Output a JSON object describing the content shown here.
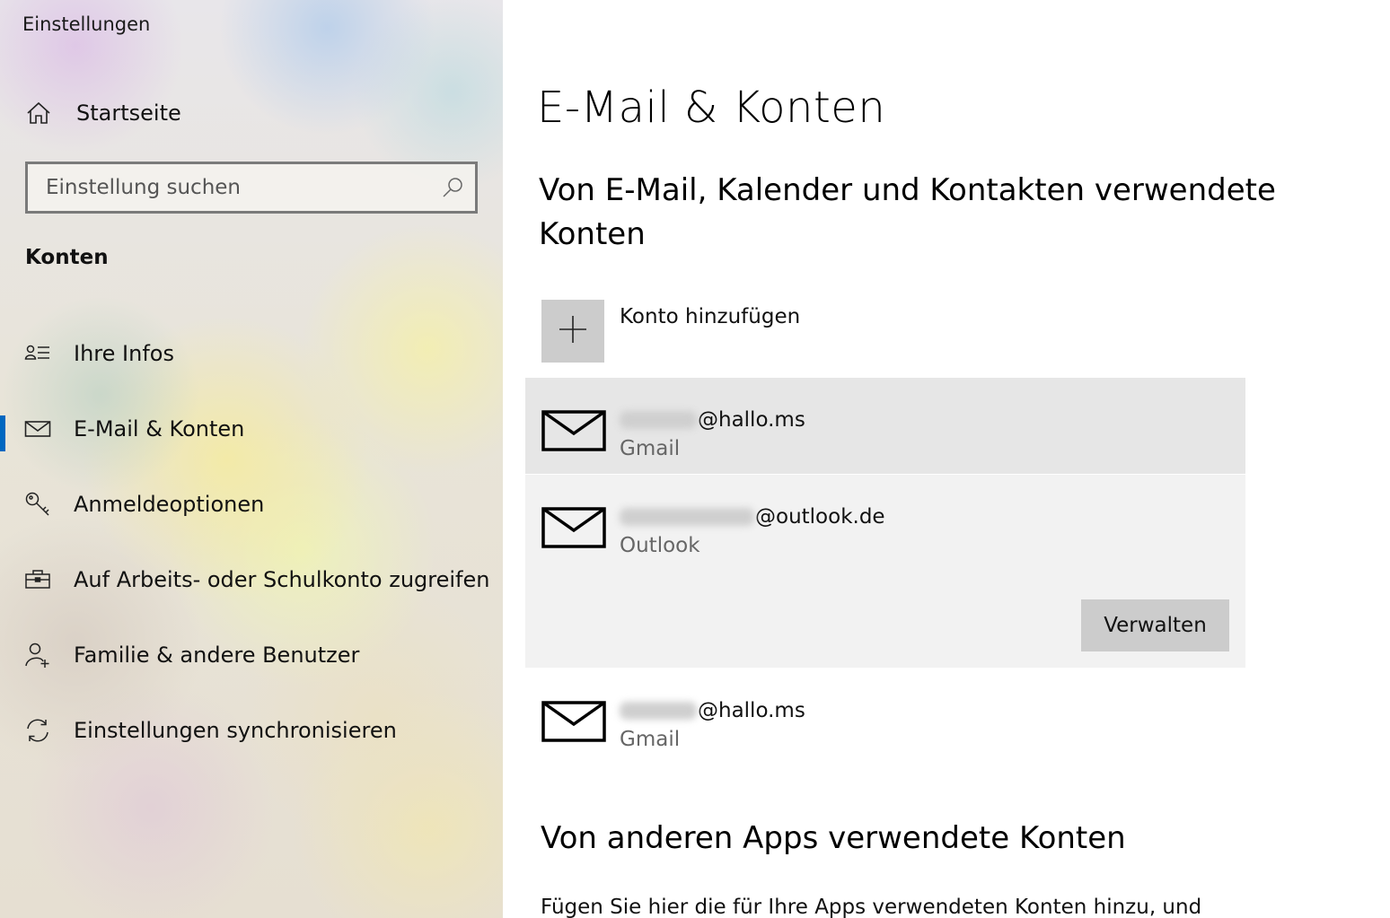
{
  "window": {
    "title": "Einstellungen"
  },
  "sidebar": {
    "home": {
      "label": "Startseite",
      "icon": "home-icon"
    },
    "search": {
      "placeholder": "Einstellung suchen",
      "value": "",
      "icon": "search-icon"
    },
    "section": "Konten",
    "items": [
      {
        "label": "Ihre Infos",
        "icon": "person-info-icon",
        "active": false
      },
      {
        "label": "E-Mail & Konten",
        "icon": "mail-icon",
        "active": true
      },
      {
        "label": "Anmeldeoptionen",
        "icon": "key-icon",
        "active": false
      },
      {
        "label": "Auf Arbeits- oder Schulkonto zugreifen",
        "icon": "briefcase-icon",
        "active": false
      },
      {
        "label": "Familie & andere Benutzer",
        "icon": "add-person-icon",
        "active": false
      },
      {
        "label": "Einstellungen synchronisieren",
        "icon": "sync-icon",
        "active": false
      }
    ],
    "accent_color": "#0067c0"
  },
  "main": {
    "title": "E-Mail & Konten",
    "section_heading": "Von E-Mail, Kalender und Kontakten verwendete Konten",
    "add_account": {
      "label": "Konto hinzufügen",
      "icon": "plus-icon"
    },
    "accounts": [
      {
        "address_suffix": "@hallo.ms",
        "provider": "Gmail",
        "icon": "mail-icon",
        "state": "hover"
      },
      {
        "address_suffix": "@outlook.de",
        "provider": "Outlook",
        "icon": "mail-icon",
        "state": "selected",
        "manage_label": "Verwalten"
      },
      {
        "address_suffix": "@hallo.ms",
        "provider": "Gmail",
        "icon": "mail-icon",
        "state": "normal"
      }
    ],
    "other_apps_heading": "Von anderen Apps verwendete Konten",
    "other_apps_description": "Fügen Sie hier die für Ihre Apps verwendeten Konten hinzu, und"
  }
}
